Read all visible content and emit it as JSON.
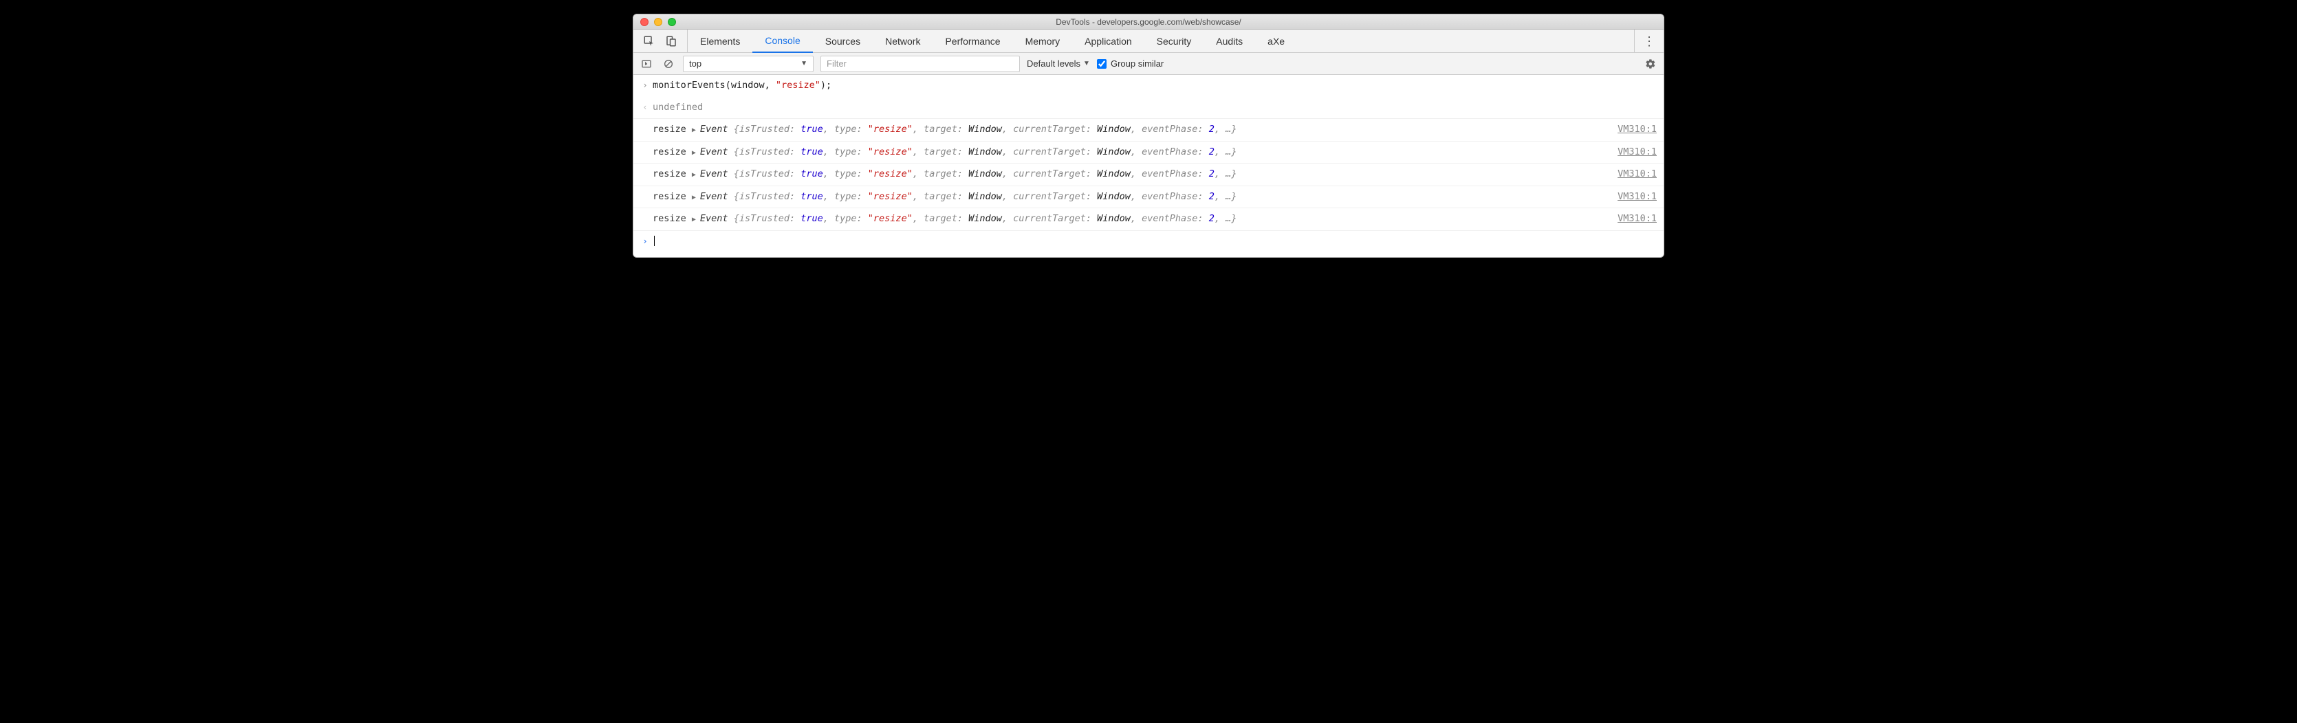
{
  "window": {
    "title": "DevTools - developers.google.com/web/showcase/"
  },
  "tabs": {
    "items": [
      "Elements",
      "Console",
      "Sources",
      "Network",
      "Performance",
      "Memory",
      "Application",
      "Security",
      "Audits",
      "aXe"
    ],
    "active": "Console"
  },
  "toolbar": {
    "context": "top",
    "filter_placeholder": "Filter",
    "levels_label": "Default levels",
    "group_similar_label": "Group similar",
    "group_similar_checked": true
  },
  "console": {
    "input_gutter": "›",
    "output_gutter": "‹",
    "command": {
      "fn": "monitorEvents",
      "arg1": "window",
      "arg2": "\"resize\"",
      "trail": ");"
    },
    "result": "undefined",
    "events": [
      {
        "name": "resize",
        "obj": "Event",
        "isTrusted": "true",
        "type": "\"resize\"",
        "target": "Window",
        "currentTarget": "Window",
        "eventPhase": "2",
        "source": "VM310:1"
      },
      {
        "name": "resize",
        "obj": "Event",
        "isTrusted": "true",
        "type": "\"resize\"",
        "target": "Window",
        "currentTarget": "Window",
        "eventPhase": "2",
        "source": "VM310:1"
      },
      {
        "name": "resize",
        "obj": "Event",
        "isTrusted": "true",
        "type": "\"resize\"",
        "target": "Window",
        "currentTarget": "Window",
        "eventPhase": "2",
        "source": "VM310:1"
      },
      {
        "name": "resize",
        "obj": "Event",
        "isTrusted": "true",
        "type": "\"resize\"",
        "target": "Window",
        "currentTarget": "Window",
        "eventPhase": "2",
        "source": "VM310:1"
      },
      {
        "name": "resize",
        "obj": "Event",
        "isTrusted": "true",
        "type": "\"resize\"",
        "target": "Window",
        "currentTarget": "Window",
        "eventPhase": "2",
        "source": "VM310:1"
      }
    ],
    "prompt": "›",
    "key_isTrusted": "isTrusted",
    "key_type": "type",
    "key_target": "target",
    "key_currentTarget": "currentTarget",
    "key_eventPhase": "eventPhase",
    "ellipsis": "…"
  }
}
